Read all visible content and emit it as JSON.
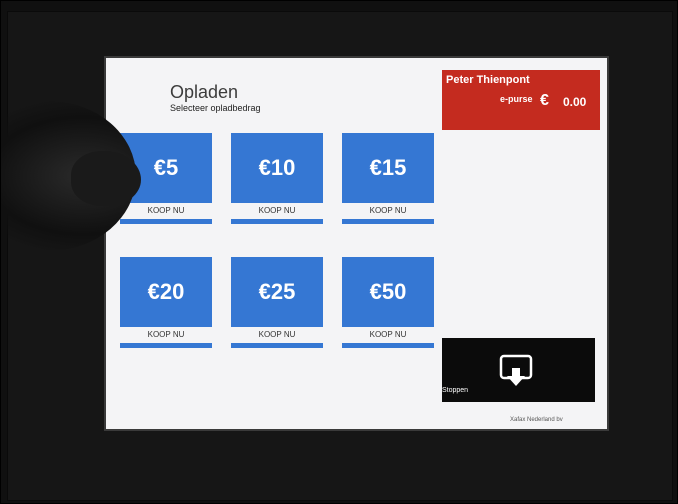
{
  "screen": {
    "title": "Opladen",
    "subtitle": "Selecteer opladbedrag"
  },
  "wallet": {
    "name": "Peter Thienpont",
    "purse_label": "e-purse",
    "currency_symbol": "€",
    "balance": "0.00",
    "color": "#c42b1f"
  },
  "amounts": [
    {
      "value": "€5",
      "action": "KOOP NU"
    },
    {
      "value": "€10",
      "action": "KOOP NU"
    },
    {
      "value": "€15",
      "action": "KOOP NU"
    },
    {
      "value": "€20",
      "action": "KOOP NU"
    },
    {
      "value": "€25",
      "action": "KOOP NU"
    },
    {
      "value": "€50",
      "action": "KOOP NU"
    }
  ],
  "stop_button": {
    "label": "Stoppen",
    "icon": "exit-icon"
  },
  "footer": {
    "text": "Xafax Nederland bv"
  },
  "colors": {
    "tile_blue": "#3577d3",
    "wallet_red": "#c42b1f",
    "stop_black": "#0b0b0b"
  }
}
